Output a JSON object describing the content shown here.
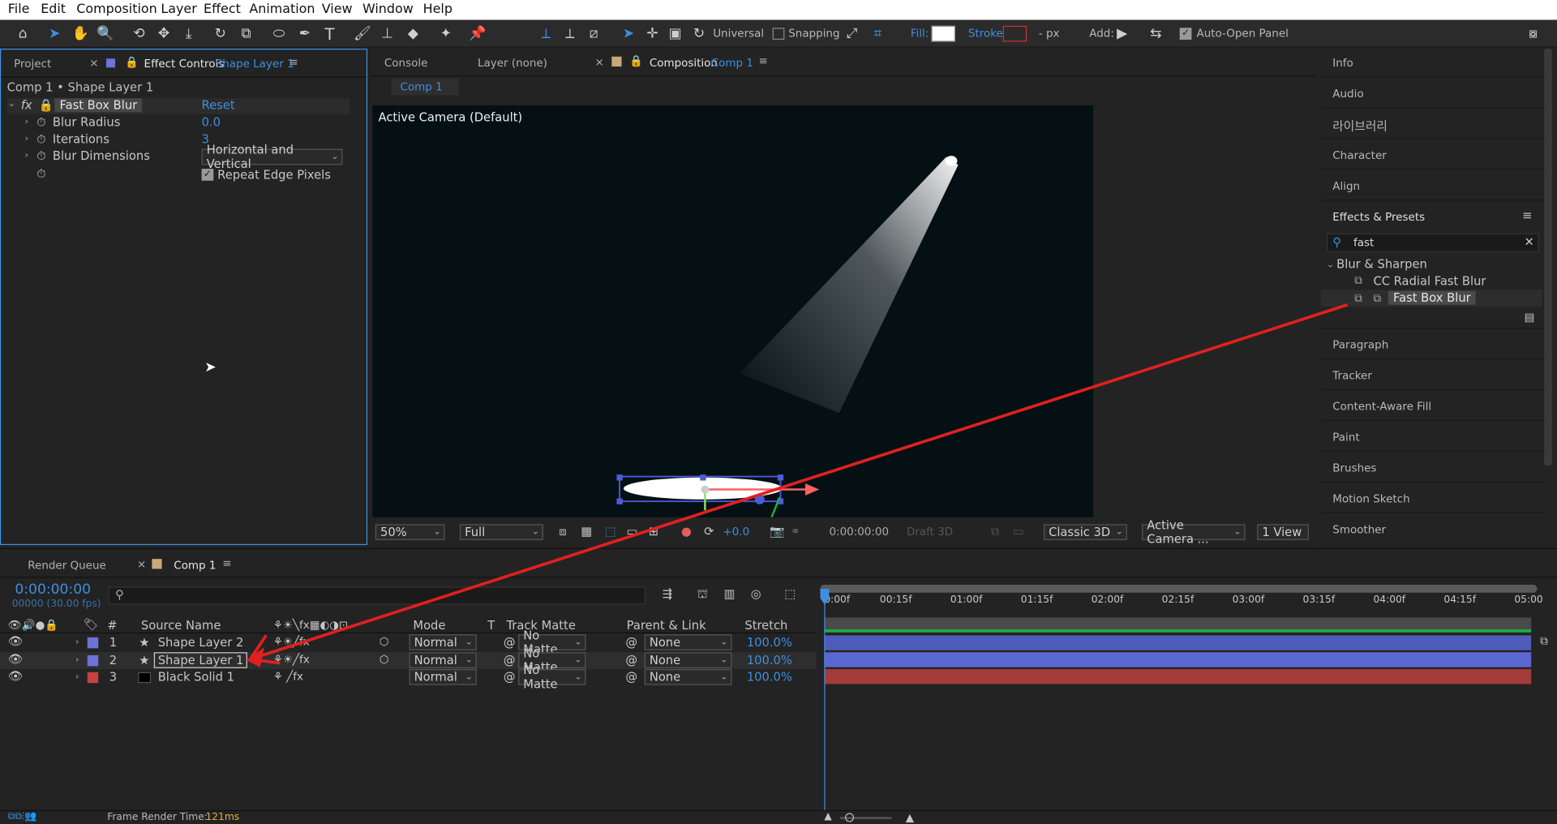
{
  "menu": [
    "File",
    "Edit",
    "Composition",
    "Layer",
    "Effect",
    "Animation",
    "View",
    "Window",
    "Help"
  ],
  "toolbar": {
    "universal": "Universal",
    "snapping": "Snapping",
    "fill": "Fill:",
    "stroke": "Stroke:",
    "px": "- px",
    "add": "Add:",
    "auto_open": "Auto-Open Panel"
  },
  "left_panel": {
    "tab_project": "Project",
    "tab_effect": "Effect Controls",
    "tab_effect_layer": "Shape Layer 1",
    "breadcrumb": "Comp 1 • Shape Layer 1",
    "effect_name": "Fast Box Blur",
    "reset": "Reset",
    "props": [
      {
        "name": "Blur Radius",
        "value": "0.0"
      },
      {
        "name": "Iterations",
        "value": "3"
      },
      {
        "name": "Blur Dimensions",
        "value": "Horizontal and Vertical"
      }
    ],
    "repeat_edge": "Repeat Edge Pixels"
  },
  "comp_panel": {
    "tab_console": "Console",
    "tab_layer": "Layer (none)",
    "tab_comp": "Composition",
    "tab_comp_name": "Comp 1",
    "subtab": "Comp 1",
    "camera_label": "Active Camera (Default)",
    "zoom": "50%",
    "resolution": "Full",
    "exposure": "+0.0",
    "timecode": "0:00:00:00",
    "draft": "Draft 3D",
    "renderer": "Classic 3D",
    "camera": "Active Camera ...",
    "views": "1 View"
  },
  "right_panel": {
    "items_top": [
      "Info",
      "Audio",
      "라이브러리",
      "Character",
      "Align"
    ],
    "effects_title": "Effects & Presets",
    "search": "fast",
    "category": "Blur & Sharpen",
    "results": [
      "CC Radial Fast Blur",
      "Fast Box Blur"
    ],
    "items_bottom": [
      "Paragraph",
      "Tracker",
      "Content-Aware Fill",
      "Paint",
      "Brushes",
      "Motion Sketch",
      "Smoother"
    ]
  },
  "timeline": {
    "tab_render": "Render Queue",
    "tab_comp": "Comp 1",
    "timecode": "0:00:00:00",
    "fps": "00000 (30.00 fps)",
    "headers": {
      "num": "#",
      "source": "Source Name",
      "mode": "Mode",
      "t": "T",
      "track": "Track Matte",
      "parent": "Parent & Link",
      "stretch": "Stretch"
    },
    "layers": [
      {
        "num": "1",
        "name": "Shape Layer 2",
        "mode": "Normal",
        "matte": "No Matte",
        "parent": "None",
        "stretch": "100.0%",
        "color": "#6b72d8"
      },
      {
        "num": "2",
        "name": "Shape Layer 1",
        "mode": "Normal",
        "matte": "No Matte",
        "parent": "None",
        "stretch": "100.0%",
        "color": "#6b72d8"
      },
      {
        "num": "3",
        "name": "Black Solid 1",
        "mode": "Normal",
        "matte": "No Matte",
        "parent": "None",
        "stretch": "100.0%",
        "color": "#c94040"
      }
    ],
    "ruler": [
      "0:00f",
      "00:15f",
      "01:00f",
      "01:15f",
      "02:00f",
      "02:15f",
      "03:00f",
      "03:15f",
      "04:00f",
      "04:15f",
      "05:00"
    ]
  },
  "status": {
    "label": "Frame Render Time:",
    "value": "121ms"
  },
  "colors": {
    "accent": "#3d8fe0",
    "arrow": "#e02020",
    "shape_bar": "#4f5bb8",
    "solid_bar": "#a33b3b"
  }
}
